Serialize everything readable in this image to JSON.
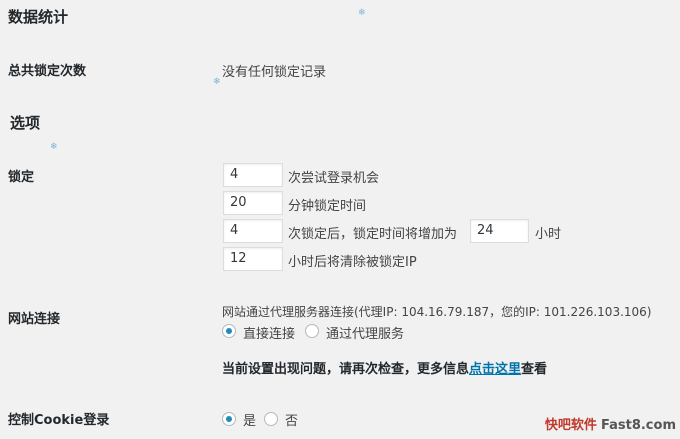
{
  "sections": {
    "stats_title": "数据统计",
    "options_title": "选项"
  },
  "stats": {
    "total_lockouts_label": "总共锁定次数",
    "total_lockouts_value": "没有任何锁定记录"
  },
  "lockout": {
    "label": "锁定",
    "allowed_retries": {
      "value": "4",
      "suffix": "次尝试登录机会"
    },
    "minutes_lockout": {
      "value": "20",
      "suffix": "分钟锁定时间"
    },
    "allowed_lockouts": {
      "value": "4",
      "middle": "次锁定后，锁定时间将增加为",
      "hours_value": "24",
      "hours_suffix": "小时"
    },
    "valid_duration": {
      "value": "12",
      "suffix": "小时后将清除被锁定IP"
    }
  },
  "connection": {
    "label": "网站连接",
    "description": "网站通过代理服务器连接(代理IP: 104.16.79.187，您的IP: 101.226.103.106)",
    "options": [
      {
        "label": "直接连接",
        "checked": true
      },
      {
        "label": "通过代理服务",
        "checked": false
      }
    ],
    "warning_prefix": "当前设置出现问题，请再次检查，更多信息",
    "warning_link": "点击这里",
    "warning_suffix": "查看"
  },
  "cookie": {
    "label": "控制Cookie登录",
    "options": [
      {
        "label": "是",
        "checked": true
      },
      {
        "label": "否",
        "checked": false
      }
    ]
  },
  "watermark": {
    "part1": "快吧软件",
    "part2": "Fast8.com"
  },
  "icons": [
    "snowflake-icon"
  ],
  "colors": {
    "accent": "#0073aa",
    "radio_dot": "#1e8cbe",
    "background": "#f1f1f1"
  }
}
